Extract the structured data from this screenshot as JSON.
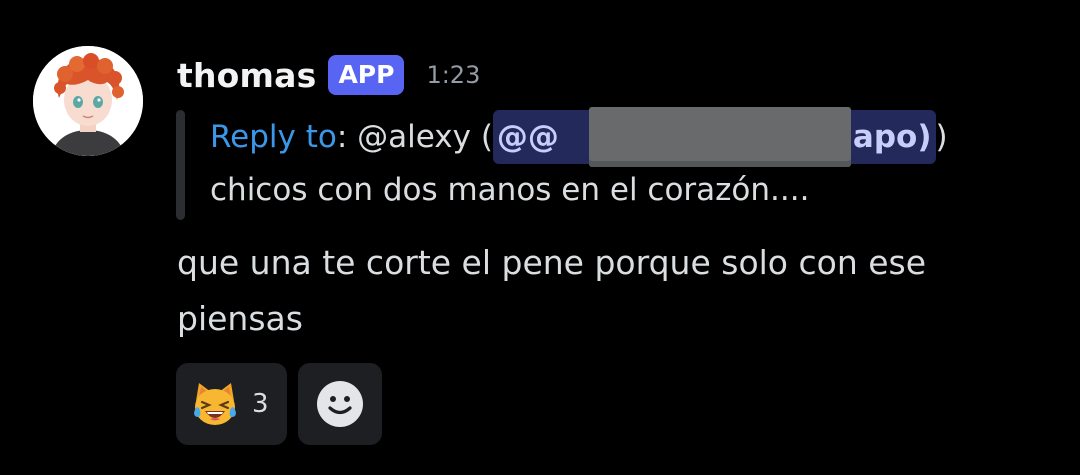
{
  "message": {
    "author": "thomas",
    "badge": "APP",
    "timestamp": "1:23",
    "reply": {
      "prefix": "Reply to",
      "separator": ": @alexy (",
      "mention_start": "@@",
      "mention_end": "apo)",
      "closing": ")",
      "quoted_text": "chicos con dos manos en el corazón...."
    },
    "content": "que una te corte el pene porque solo con ese piensas"
  },
  "reactions": [
    {
      "emoji": "joy-cat-icon",
      "count": "3"
    }
  ],
  "add_reaction": {
    "icon": "add-reaction-smile-icon"
  },
  "colors": {
    "background": "#000000",
    "badge": "#5865f2",
    "reply_link": "#3b98e8",
    "mention_bg": "#23295a",
    "reaction_bg": "#1e1f22"
  }
}
